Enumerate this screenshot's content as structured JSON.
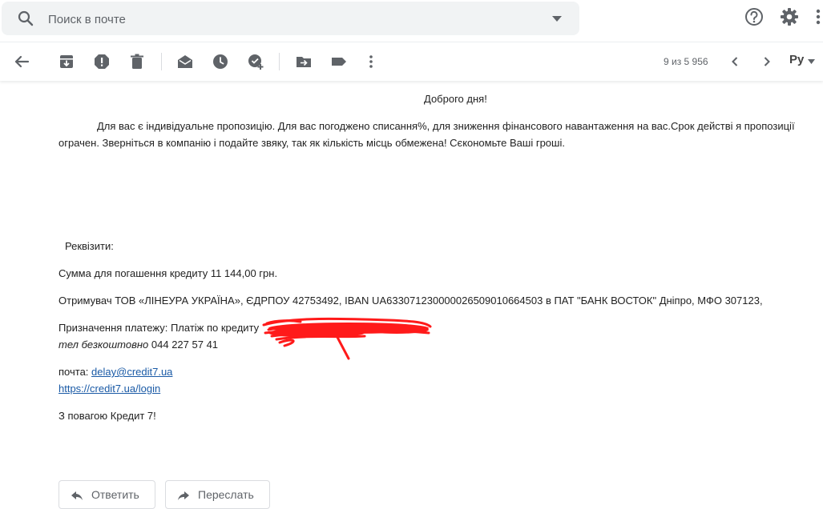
{
  "search": {
    "placeholder": "Поиск в почте"
  },
  "pager": {
    "text": "9 из 5 956"
  },
  "language": {
    "label": "Ру"
  },
  "email": {
    "greeting": "Доброго дня!",
    "paragraph": "Для вас є індивідуальне пропозицію. Для вас погоджено списання%, для зниження фінансового навантаження на вас.Срок действі я пропозиції ограчен. Зверніться в компанію і подайте звяку, так як кількість місць обмежена! Сєкономьте Ваші гроші.",
    "requisites_label": "Реквізити:",
    "amount_line": "Сумма для погашення кредиту 11 144,00 грн.",
    "recipient_line": "Отримувач ТОВ «ЛІНЕУРА УКРАЇНА», ЄДРПОУ 42753492, IBAN UA633071230000026509010664503 в ПАТ \"БАНК ВОСТОК\" Дніпро, МФО 307123,",
    "purpose_line": "Призначення платежу: Платіж по кредиту",
    "phone_label": "тел безкоштовно",
    "phone_number": "044 227 57 41",
    "mail_label": "почта:",
    "mail_link": "delay@credit7.ua",
    "site_link": "https://credit7.ua/login",
    "signoff": "З повагою Кредит 7!"
  },
  "actions": {
    "reply": "Ответить",
    "forward": "Переслать"
  },
  "colors": {
    "link": "#1a5aa6",
    "scribble": "#ff1a1a",
    "icon": "#5f6368",
    "search_bg": "#f1f3f4"
  }
}
